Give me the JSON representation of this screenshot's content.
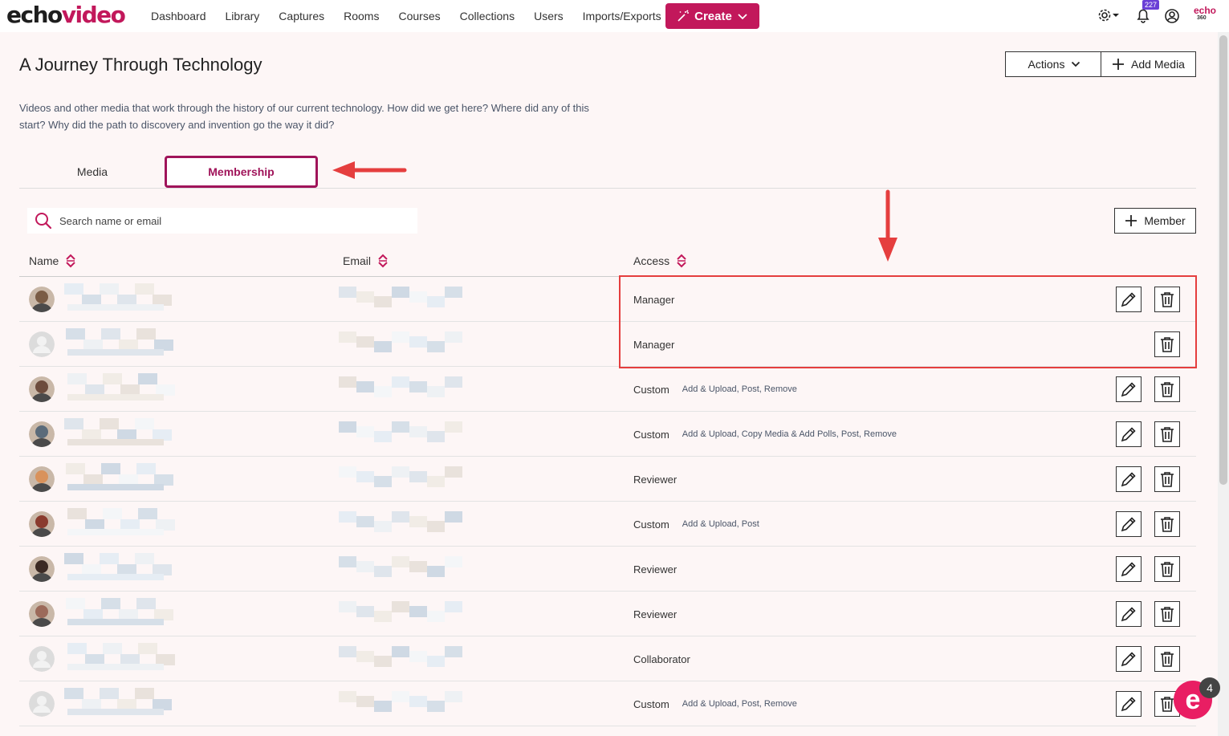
{
  "logo": {
    "part1": "echo",
    "part2": "video"
  },
  "nav": {
    "items": [
      "Dashboard",
      "Library",
      "Captures",
      "Rooms",
      "Courses",
      "Collections",
      "Users",
      "Imports/Exports"
    ],
    "create_label": "Create"
  },
  "notifications": {
    "count": "227"
  },
  "brand_corner": {
    "line1": "echo",
    "line2": "360"
  },
  "header": {
    "title": "A Journey Through Technology",
    "actions_label": "Actions",
    "add_media_label": "Add Media",
    "description": "Videos and other media that work through the history of our current technology. How did we get here? Where did any of this start? Why did the path to discovery and invention go the way it did?"
  },
  "tabs": [
    {
      "label": "Media"
    },
    {
      "label": "Membership"
    }
  ],
  "search": {
    "placeholder": "Search name or email"
  },
  "member_button_label": "Member",
  "table": {
    "columns": [
      "Name",
      "Email",
      "Access"
    ],
    "rows": [
      {
        "access": "Manager",
        "permissions": "",
        "avatar": "photo",
        "editable": true
      },
      {
        "access": "Manager",
        "permissions": "",
        "avatar": "default",
        "editable": false
      },
      {
        "access": "Custom",
        "permissions": "Add & Upload, Post, Remove",
        "avatar": "photo",
        "editable": true
      },
      {
        "access": "Custom",
        "permissions": "Add & Upload, Copy Media & Add Polls, Post, Remove",
        "avatar": "photo",
        "editable": true
      },
      {
        "access": "Reviewer",
        "permissions": "",
        "avatar": "photo",
        "editable": true
      },
      {
        "access": "Custom",
        "permissions": "Add & Upload, Post",
        "avatar": "photo",
        "editable": true
      },
      {
        "access": "Reviewer",
        "permissions": "",
        "avatar": "photo",
        "editable": true
      },
      {
        "access": "Reviewer",
        "permissions": "",
        "avatar": "photo",
        "editable": true
      },
      {
        "access": "Collaborator",
        "permissions": "",
        "avatar": "default",
        "editable": true
      },
      {
        "access": "Custom",
        "permissions": "Add & Upload, Post, Remove",
        "avatar": "default",
        "editable": true
      }
    ]
  },
  "chat": {
    "badge": "4",
    "glyph": "e"
  },
  "colors": {
    "brand": "#c2185b",
    "annotation": "#e53e3e",
    "badge": "#6a3fd6"
  }
}
